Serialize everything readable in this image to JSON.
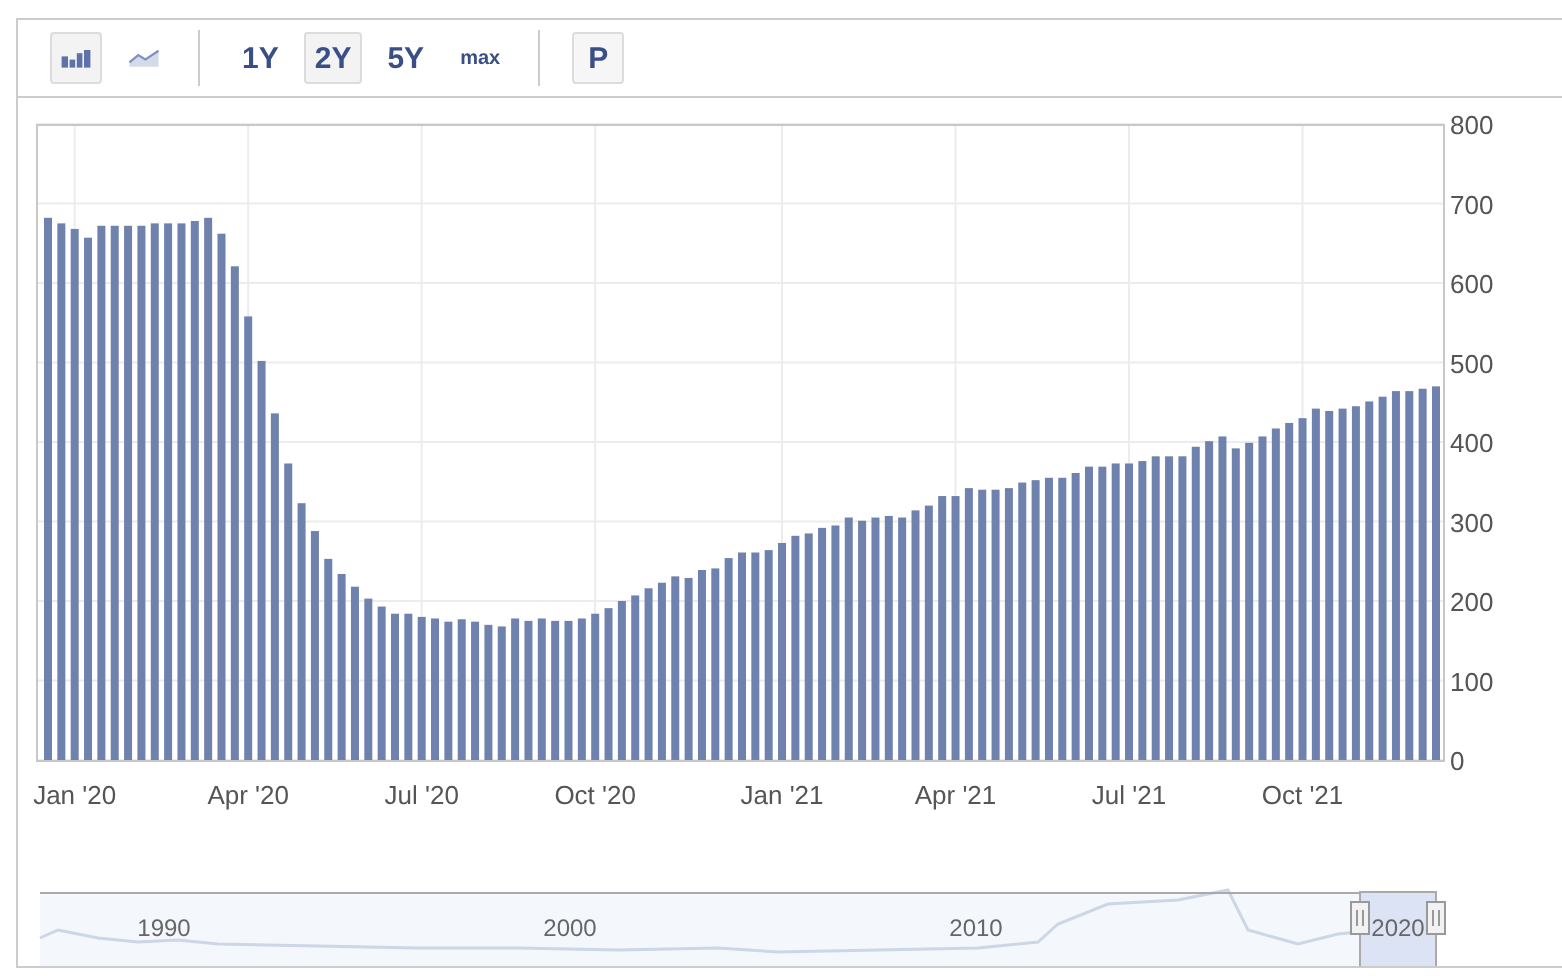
{
  "toolbar": {
    "chart_types": [
      {
        "kind": "bar",
        "selected": true
      },
      {
        "kind": "line",
        "selected": false
      }
    ],
    "ranges": [
      {
        "label": "1Y",
        "kind": "period",
        "selected": false
      },
      {
        "label": "2Y",
        "kind": "period",
        "selected": true
      },
      {
        "label": "5Y",
        "kind": "period",
        "selected": false
      },
      {
        "label": "max",
        "kind": "all",
        "selected": false
      }
    ],
    "p_button": "P"
  },
  "chart": {
    "chart_data": {
      "type": "bar",
      "color": "#6f82ad",
      "values": [
        682,
        675,
        668,
        657,
        672,
        672,
        672,
        672,
        675,
        675,
        675,
        678,
        682,
        662,
        621,
        558,
        502,
        436,
        373,
        323,
        288,
        253,
        234,
        218,
        203,
        193,
        184,
        184,
        180,
        178,
        174,
        177,
        174,
        170,
        168,
        178,
        175,
        178,
        175,
        175,
        178,
        184,
        191,
        200,
        207,
        216,
        223,
        231,
        229,
        239,
        241,
        254,
        261,
        261,
        264,
        273,
        282,
        285,
        292,
        295,
        305,
        301,
        305,
        307,
        305,
        314,
        320,
        332,
        332,
        342,
        340,
        340,
        342,
        349,
        352,
        355,
        355,
        361,
        369,
        369,
        373,
        373,
        376,
        382,
        382,
        382,
        394,
        401,
        407,
        392,
        399,
        407,
        417,
        424,
        430,
        442,
        439,
        442,
        445,
        451,
        457,
        464,
        464,
        467,
        470
      ],
      "categories": [
        null,
        null,
        "Jan '20",
        null,
        null,
        null,
        null,
        null,
        null,
        null,
        null,
        null,
        null,
        null,
        null,
        "Apr '20",
        null,
        null,
        null,
        null,
        null,
        null,
        null,
        null,
        null,
        null,
        null,
        null,
        "Jul '20",
        null,
        null,
        null,
        null,
        null,
        null,
        null,
        null,
        null,
        null,
        null,
        null,
        "Oct '20",
        null,
        null,
        null,
        null,
        null,
        null,
        null,
        null,
        null,
        null,
        null,
        null,
        null,
        "Jan '21",
        null,
        null,
        null,
        null,
        null,
        null,
        null,
        null,
        null,
        null,
        null,
        null,
        "Apr '21",
        null,
        null,
        null,
        null,
        null,
        null,
        null,
        null,
        null,
        null,
        null,
        null,
        "Jul '21",
        null,
        null,
        null,
        null,
        null,
        null,
        null,
        null,
        null,
        null,
        null,
        null,
        "Oct '21",
        null,
        null,
        null,
        null,
        null,
        null,
        null,
        null,
        null,
        null
      ],
      "grid": true,
      "ylim": [
        0,
        800
      ],
      "yticks": [
        0,
        100,
        200,
        300,
        400,
        500,
        600,
        700,
        800
      ]
    }
  },
  "navigator": {
    "years": [
      "1990",
      "2000",
      "2010",
      "2020"
    ]
  }
}
